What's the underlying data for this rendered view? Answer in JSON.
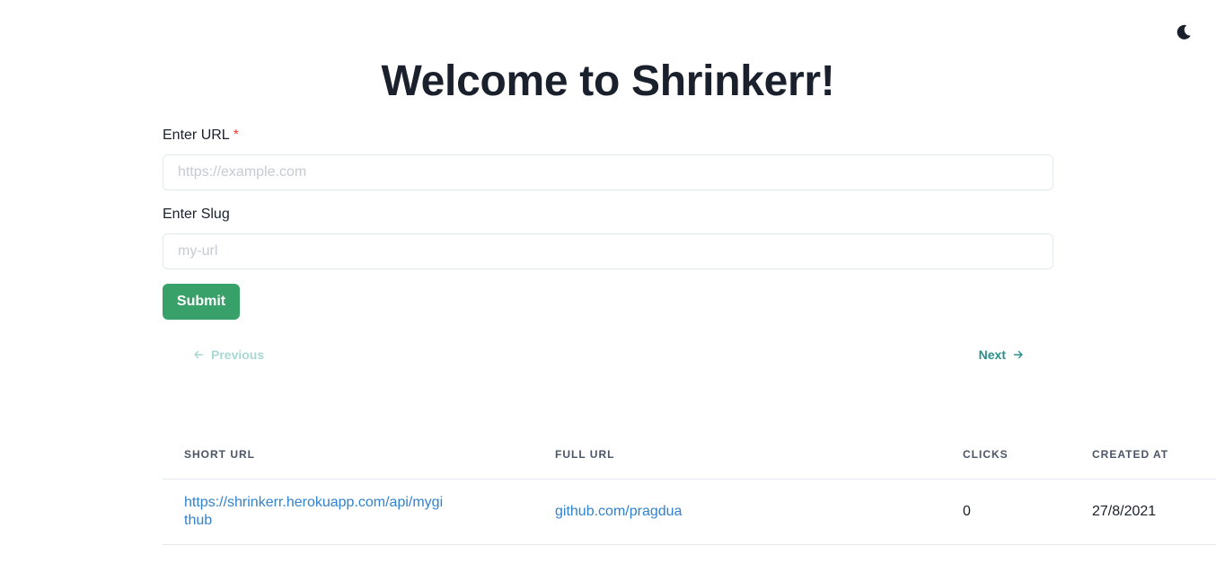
{
  "header": {
    "title": "Welcome to Shrinkerr!",
    "theme_toggle_icon": "moon-icon"
  },
  "form": {
    "url_label": "Enter URL",
    "url_required_mark": "*",
    "url_placeholder": "https://example.com",
    "url_value": "",
    "slug_label": "Enter Slug",
    "slug_placeholder": "my-url",
    "slug_value": "",
    "submit_label": "Submit"
  },
  "pagination": {
    "previous_label": "Previous",
    "next_label": "Next"
  },
  "table": {
    "headers": {
      "short_url": "Short URL",
      "full_url": "Full URL",
      "clicks": "Clicks",
      "created_at": "Created At"
    },
    "rows": [
      {
        "short_url": "https://shrinkerr.herokuapp.com/api/mygithub",
        "full_url": "github.com/pragdua",
        "clicks": "0",
        "created_at": "27/8/2021"
      }
    ]
  },
  "colors": {
    "submit_bg": "#38a169",
    "link": "#3182ce",
    "pager_active": "#2c8f8a",
    "pager_disabled": "#a9d8d4",
    "required": "#e53e3e"
  }
}
